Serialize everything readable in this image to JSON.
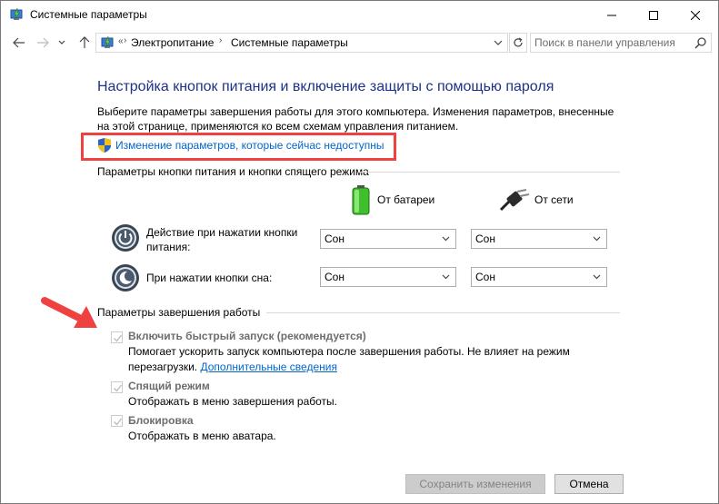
{
  "window": {
    "title": "Системные параметры"
  },
  "address": {
    "sep": "«",
    "crumbs": [
      "Электропитание",
      "Системные параметры"
    ],
    "search_placeholder": "Поиск в панели управления"
  },
  "content": {
    "heading": "Настройка кнопок питания и включение защиты с помощью пароля",
    "desc_line1": "Выберите параметры завершения работы для этого компьютера. Изменения параметров, внесенные",
    "desc_line2": "на этой странице, применяются ко всем схемам управления питанием.",
    "change_link": "Изменение параметров, которые сейчас недоступны",
    "highlight_color": "#f04141",
    "link_color": "#0066cc",
    "heading_color": "#1e3287"
  },
  "power_buttons": {
    "section_title": "Параметры кнопки питания и кнопки спящего режима",
    "col_battery": "От батареи",
    "col_plugged": "От сети",
    "rows": [
      {
        "label_line1": "Действие при нажатии кнопки",
        "label_line2": "питания:",
        "battery": "Сон",
        "plugged": "Сон",
        "icon": "power-button-icon"
      },
      {
        "label_line1": "При нажатии кнопки сна:",
        "label_line2": "",
        "battery": "Сон",
        "plugged": "Сон",
        "icon": "sleep-button-icon"
      }
    ]
  },
  "shutdown": {
    "section_title": "Параметры завершения работы",
    "items": [
      {
        "title": "Включить быстрый запуск (рекомендуется)",
        "desc_line1": "Помогает ускорить запуск компьютера после завершения работы. Не влияет на режим",
        "desc_line2": "перезагрузки.",
        "link": "Дополнительные сведения",
        "checked": true
      },
      {
        "title": "Спящий режим",
        "desc_line1": "Отображать в меню завершения работы.",
        "checked": true
      },
      {
        "title": "Блокировка",
        "desc_line1": "Отображать в меню аватара.",
        "checked": true
      }
    ]
  },
  "buttons": {
    "save": "Сохранить изменения",
    "cancel": "Отмена"
  }
}
